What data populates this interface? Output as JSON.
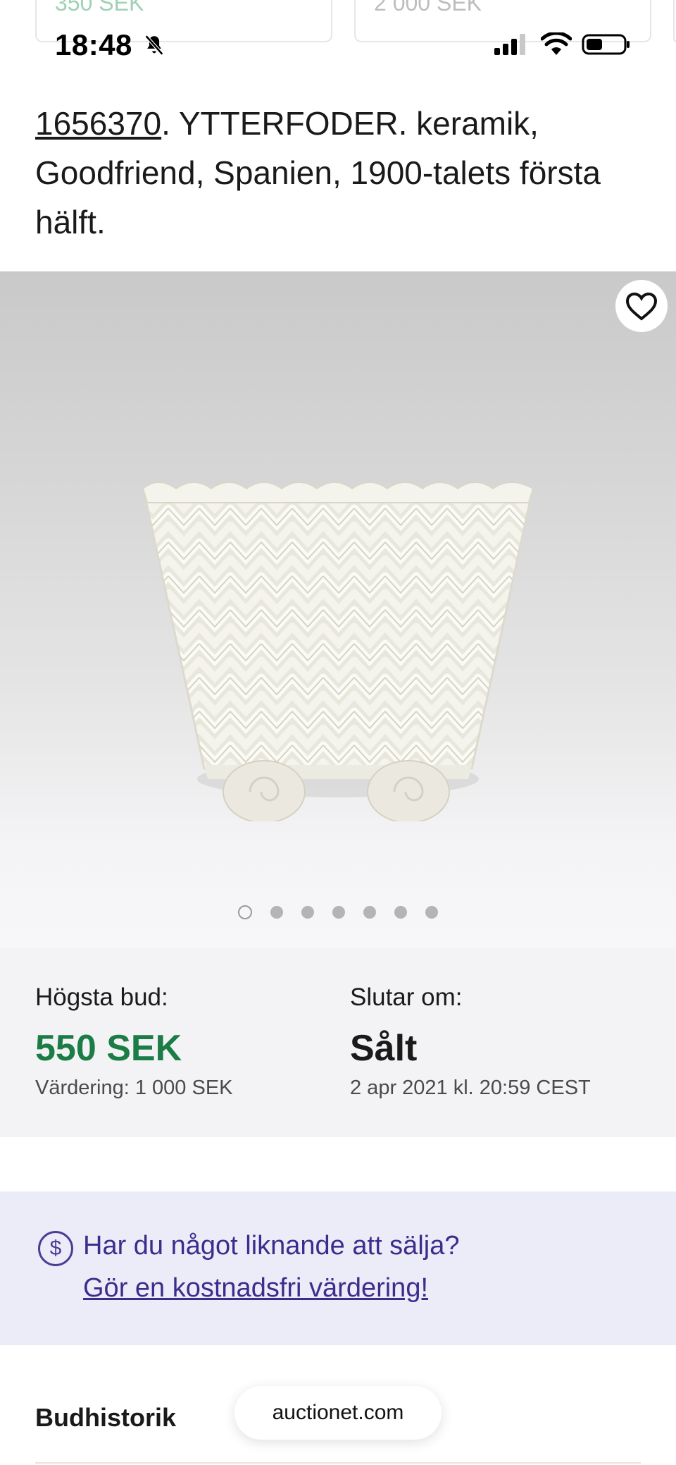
{
  "peek_cards": [
    {
      "price": "350 SEK"
    },
    {
      "price": "2 000 SEK"
    }
  ],
  "status_bar": {
    "time": "18:48",
    "icons": [
      "bell-slash-icon",
      "cellular-signal-icon",
      "wifi-icon",
      "battery-icon"
    ]
  },
  "lot": {
    "number": "1656370",
    "title_rest": ". YTTERFODER. keramik, Goodfriend, Spanien, 1900-talets första hälft."
  },
  "gallery": {
    "image_count": 7,
    "active_index": 0,
    "favorite_icon": "heart-icon"
  },
  "bid_info": {
    "highest_label": "Högsta bud:",
    "highest_value": "550 SEK",
    "valuation": "Värdering: 1 000 SEK",
    "ends_label": "Slutar om:",
    "ends_value": "Sålt",
    "ends_date": "2 apr 2021 kl. 20:59 CEST"
  },
  "promo": {
    "icon": "dollar-circle-icon",
    "question": "Har du något liknande att sälja?",
    "link": "Gör en kostnadsfri värdering!"
  },
  "bid_history_heading": "Budhistorik",
  "browser": {
    "url": "auctionet.com"
  },
  "colors": {
    "green_price": "#1c7c45",
    "promo_bg": "#ececf8",
    "promo_text": "#3e2c8c"
  }
}
